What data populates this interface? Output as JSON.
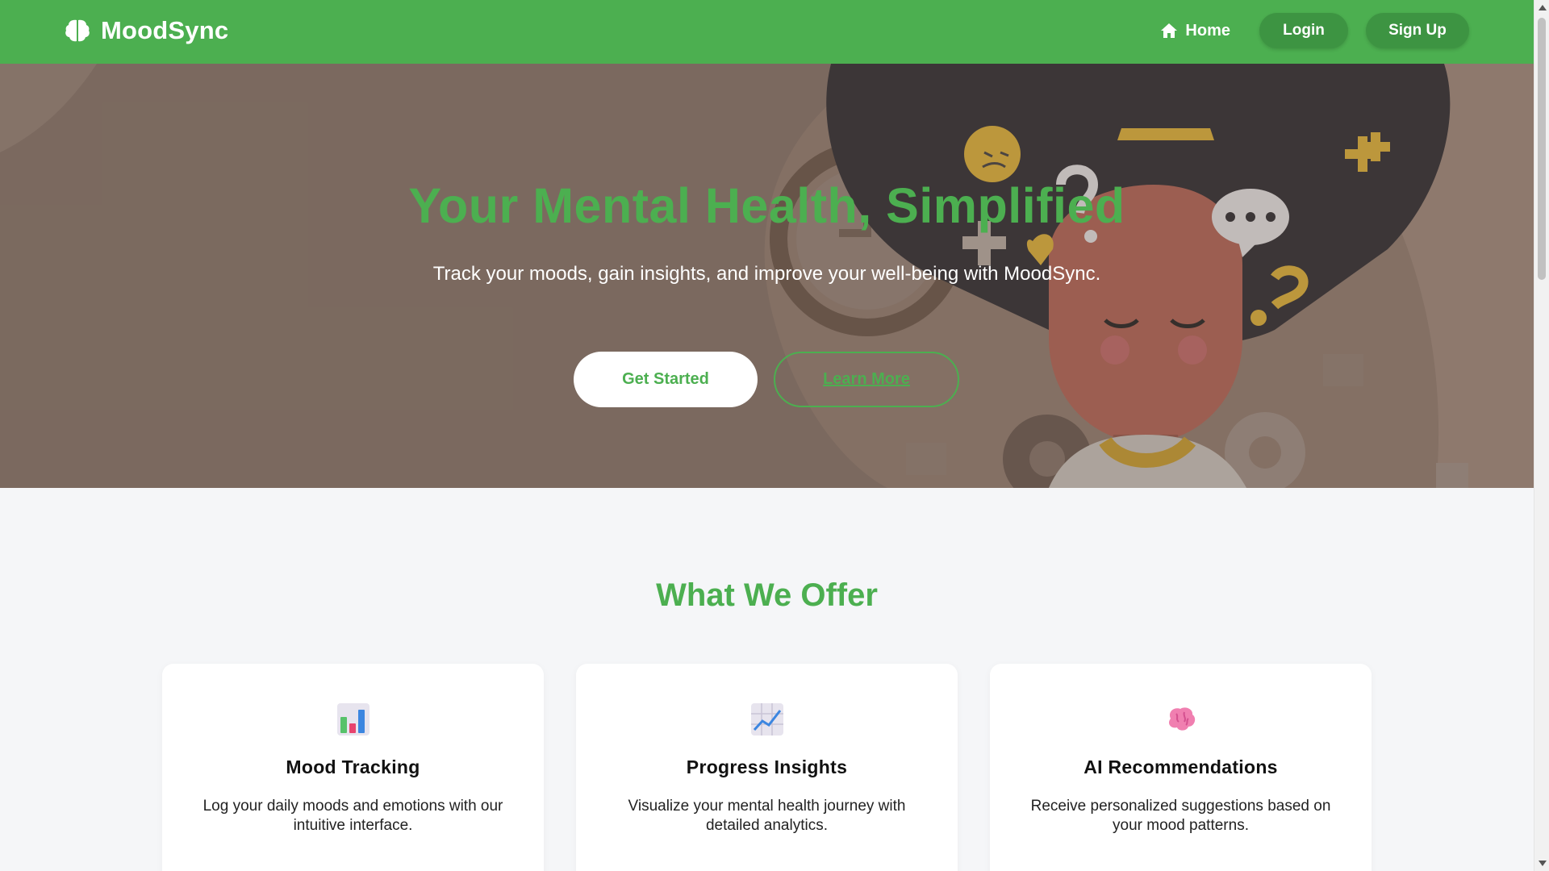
{
  "nav": {
    "brand": "MoodSync",
    "home_label": "Home",
    "login_label": "Login",
    "signup_label": "Sign Up"
  },
  "hero": {
    "title": "Your Mental Health, Simplified",
    "subtitle": "Track your moods, gain insights, and improve your well-being with MoodSync.",
    "primary_button": "Get Started",
    "secondary_button": "Learn More"
  },
  "offer": {
    "title": "What We Offer",
    "cards": [
      {
        "icon": "bar-chart-icon",
        "title": "Mood Tracking",
        "description": "Log your daily moods and emotions with our intuitive interface."
      },
      {
        "icon": "trend-chart-icon",
        "title": "Progress Insights",
        "description": "Visualize your mental health journey with detailed analytics."
      },
      {
        "icon": "brain-icon",
        "title": "AI Recommendations",
        "description": "Receive personalized suggestions based on your mood patterns."
      }
    ]
  },
  "colors": {
    "brand_green": "#4caf50",
    "dark_green": "#3d9442",
    "hero_bg": "#7d6b60",
    "page_bg": "#f5f6f8"
  }
}
